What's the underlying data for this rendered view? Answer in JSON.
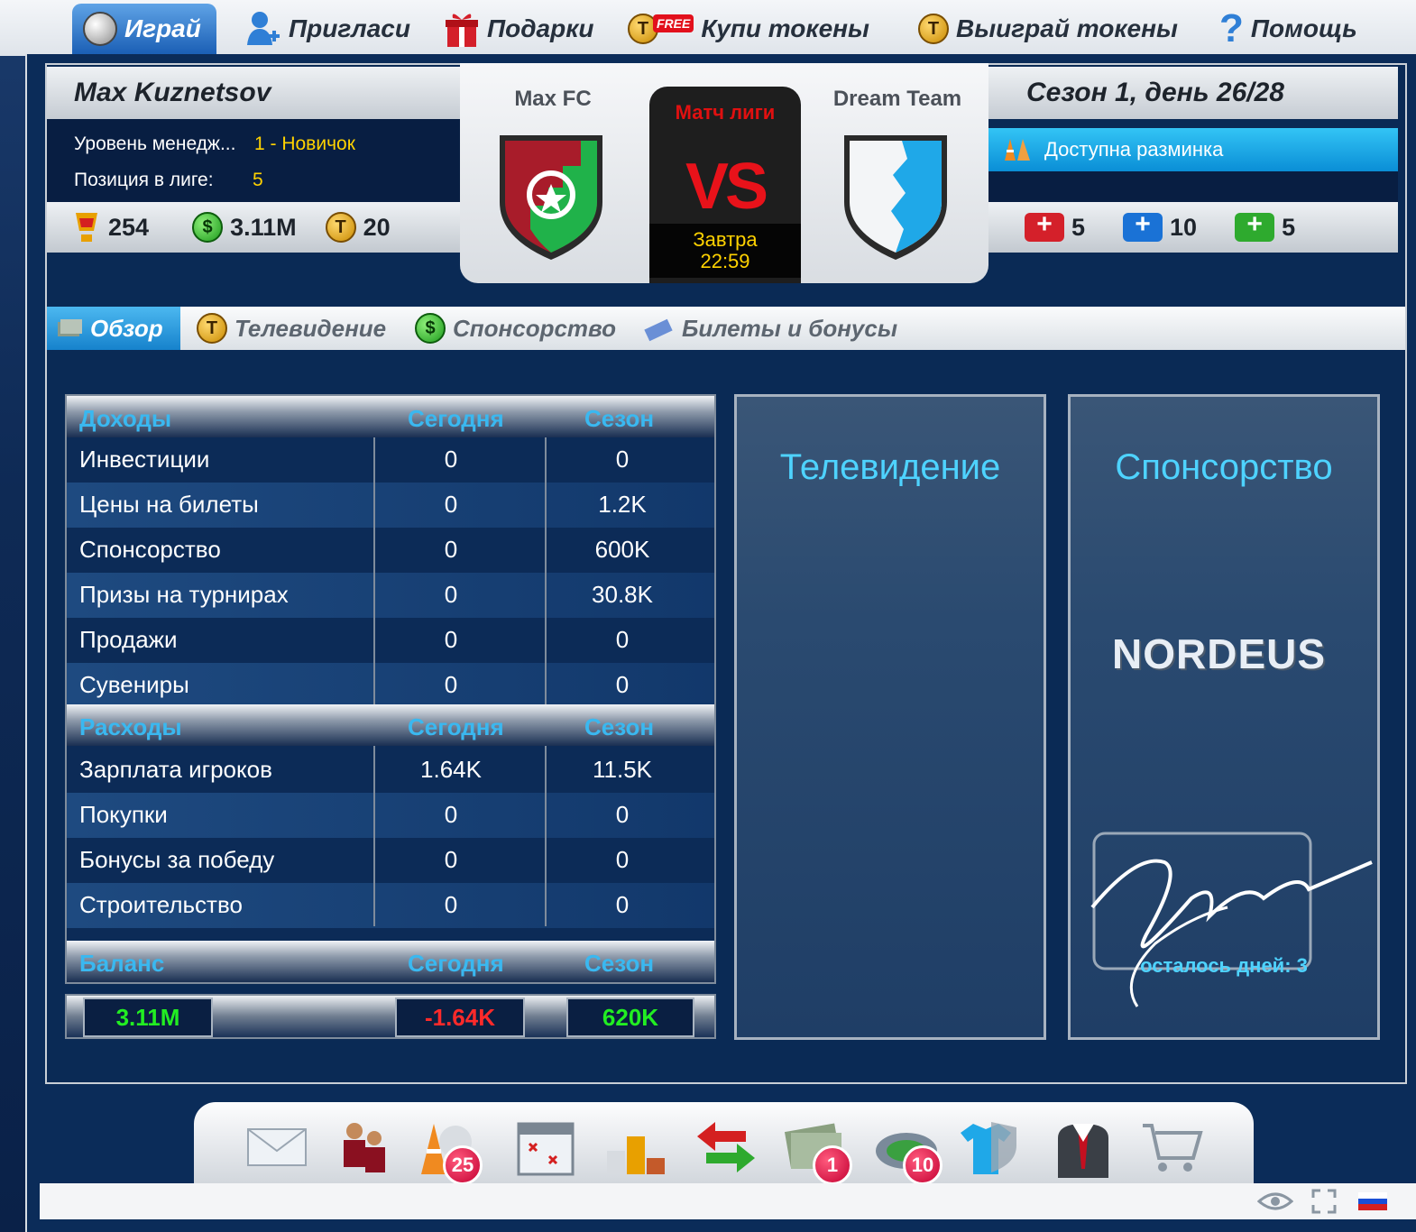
{
  "nav": {
    "play": "Играй",
    "invite": "Пригласи",
    "gifts": "Подарки",
    "free_badge": "FREE",
    "buy_tokens": "Купи токены",
    "win_tokens": "Выиграй токены",
    "help": "Помощь",
    "token_letter": "T"
  },
  "manager": {
    "name": "Max Kuznetsov",
    "level_label": "Уровень менедж...",
    "level_value": "1 - Новичок",
    "position_label": "Позиция в лиге:",
    "position_value": "5",
    "trophies": "254",
    "money": "3.11M",
    "money_symbol": "$",
    "tokens": "20"
  },
  "match": {
    "home_team": "Max FC",
    "away_team": "Dream Team",
    "type": "Матч лиги",
    "vs": "VS",
    "day": "Завтра",
    "time": "22:59"
  },
  "season": {
    "title": "Сезон 1, день 26/28",
    "warmup": "Доступна разминка",
    "kits": [
      {
        "value": "5",
        "color": "#d4202a"
      },
      {
        "value": "10",
        "color": "#1a72d6"
      },
      {
        "value": "5",
        "color": "#2eaa2e"
      }
    ]
  },
  "subtabs": {
    "overview": "Обзор",
    "tv": "Телевидение",
    "sponsorship": "Спонсорство",
    "tickets": "Билеты и бонусы"
  },
  "finance": {
    "income_header": "Доходы",
    "today_header": "Сегодня",
    "season_header": "Сезон",
    "income": [
      {
        "label": "Инвестиции",
        "today": "0",
        "season": "0"
      },
      {
        "label": "Цены на билеты",
        "today": "0",
        "season": "1.2K"
      },
      {
        "label": "Спонсорство",
        "today": "0",
        "season": "600K"
      },
      {
        "label": "Призы на турнирах",
        "today": "0",
        "season": "30.8K"
      },
      {
        "label": "Продажи",
        "today": "0",
        "season": "0"
      },
      {
        "label": "Сувениры",
        "today": "0",
        "season": "0"
      }
    ],
    "expenses_header": "Расходы",
    "expenses": [
      {
        "label": "Зарплата игроков",
        "today": "1.64K",
        "season": "11.5K"
      },
      {
        "label": "Покупки",
        "today": "0",
        "season": "0"
      },
      {
        "label": "Бонусы за победу",
        "today": "0",
        "season": "0"
      },
      {
        "label": "Строительство",
        "today": "0",
        "season": "0"
      }
    ],
    "balance_header": "Баланс",
    "balance_total": "3.11M",
    "balance_today": "-1.64K",
    "balance_season": "620K",
    "colors": {
      "positive": "#22ee22",
      "negative": "#ff2a2a"
    }
  },
  "tv_panel": {
    "title": "Телевидение"
  },
  "sponsor_panel": {
    "title": "Спонсорство",
    "sponsor": "NORDEUS",
    "days_left": "осталось дней: 3"
  },
  "dock": {
    "icons": [
      "mail-icon",
      "squad-icon",
      "training-icon",
      "calendar-icon",
      "league-table-icon",
      "transfers-icon",
      "finances-icon",
      "stadium-icon",
      "club-kit-icon",
      "manager-icon",
      "shop-icon"
    ],
    "badges": {
      "training": "25",
      "finances": "1",
      "stadium": "10"
    }
  }
}
